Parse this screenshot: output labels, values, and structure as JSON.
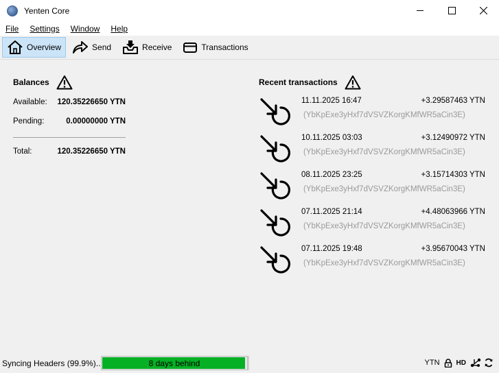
{
  "window": {
    "title": "Yenten Core",
    "controls": [
      "minimize-icon",
      "maximize-icon",
      "close-icon"
    ]
  },
  "menu": {
    "items": [
      {
        "label": "File"
      },
      {
        "label": "Settings"
      },
      {
        "label": "Window"
      },
      {
        "label": "Help"
      }
    ]
  },
  "toolbar": {
    "items": [
      {
        "label": "Overview",
        "icon": "home-icon",
        "active": true
      },
      {
        "label": "Send",
        "icon": "send-arrow-icon"
      },
      {
        "label": "Receive",
        "icon": "receive-inbox-icon"
      },
      {
        "label": "Transactions",
        "icon": "card-icon"
      }
    ]
  },
  "balances": {
    "title": "Balances",
    "warning_icon": "warning-icon",
    "available_label": "Available:",
    "available_value": "120.35226650 YTN",
    "pending_label": "Pending:",
    "pending_value": "0.00000000 YTN",
    "total_label": "Total:",
    "total_value": "120.35226650 YTN"
  },
  "recent": {
    "title": "Recent transactions",
    "warning_icon": "warning-icon",
    "transactions": [
      {
        "date": "11.11.2025 16:47",
        "amount": "+3.29587463 YTN",
        "address": "(YbKpExe3yHxf7dVSVZKorgKMfWR5aCin3E)",
        "icon": "received-pending-icon"
      },
      {
        "date": "10.11.2025 03:03",
        "amount": "+3.12490972 YTN",
        "address": "(YbKpExe3yHxf7dVSVZKorgKMfWR5aCin3E)",
        "icon": "received-pending-icon"
      },
      {
        "date": "08.11.2025 23:25",
        "amount": "+3.15714303 YTN",
        "address": "(YbKpExe3yHxf7dVSVZKorgKMfWR5aCin3E)",
        "icon": "received-pending-icon"
      },
      {
        "date": "07.11.2025 21:14",
        "amount": "+4.48063966 YTN",
        "address": "(YbKpExe3yHxf7dVSVZKorgKMfWR5aCin3E)",
        "icon": "received-pending-icon"
      },
      {
        "date": "07.11.2025 19:48",
        "amount": "+3.95670043 YTN",
        "address": "(YbKpExe3yHxf7dVSVZKorgKMfWR5aCin3E)",
        "icon": "received-pending-icon"
      }
    ]
  },
  "status": {
    "sync_text": "Syncing Headers (99.9%)...",
    "progress_text": "8 days behind",
    "progress_fraction": 0.99,
    "progress_color": "#06b025",
    "unit": "YTN",
    "hd_label": "HD",
    "icons": [
      "lock-icon",
      "hd-icon",
      "network-icon",
      "sync-icon"
    ]
  }
}
